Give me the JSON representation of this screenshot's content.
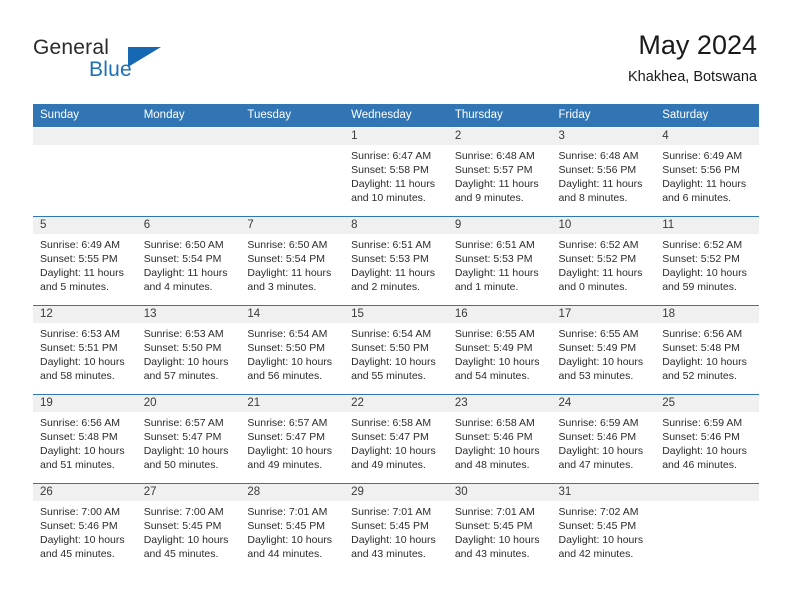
{
  "brand": {
    "name_part1": "General",
    "name_part2": "Blue",
    "accent_color": "#1668b3"
  },
  "header": {
    "title": "May 2024",
    "subtitle": "Khakhea, Botswana"
  },
  "theme": {
    "header_blue": "#3175b4",
    "daynum_strip": "#f0f0f0",
    "text": "#2b2b2b"
  },
  "weekdays": [
    "Sunday",
    "Monday",
    "Tuesday",
    "Wednesday",
    "Thursday",
    "Friday",
    "Saturday"
  ],
  "weeks": [
    [
      {
        "day": "",
        "sunrise": "",
        "sunset": "",
        "daylight1": "",
        "daylight2": ""
      },
      {
        "day": "",
        "sunrise": "",
        "sunset": "",
        "daylight1": "",
        "daylight2": ""
      },
      {
        "day": "",
        "sunrise": "",
        "sunset": "",
        "daylight1": "",
        "daylight2": ""
      },
      {
        "day": "1",
        "sunrise": "Sunrise: 6:47 AM",
        "sunset": "Sunset: 5:58 PM",
        "daylight1": "Daylight: 11 hours",
        "daylight2": "and 10 minutes."
      },
      {
        "day": "2",
        "sunrise": "Sunrise: 6:48 AM",
        "sunset": "Sunset: 5:57 PM",
        "daylight1": "Daylight: 11 hours",
        "daylight2": "and 9 minutes."
      },
      {
        "day": "3",
        "sunrise": "Sunrise: 6:48 AM",
        "sunset": "Sunset: 5:56 PM",
        "daylight1": "Daylight: 11 hours",
        "daylight2": "and 8 minutes."
      },
      {
        "day": "4",
        "sunrise": "Sunrise: 6:49 AM",
        "sunset": "Sunset: 5:56 PM",
        "daylight1": "Daylight: 11 hours",
        "daylight2": "and 6 minutes."
      }
    ],
    [
      {
        "day": "5",
        "sunrise": "Sunrise: 6:49 AM",
        "sunset": "Sunset: 5:55 PM",
        "daylight1": "Daylight: 11 hours",
        "daylight2": "and 5 minutes."
      },
      {
        "day": "6",
        "sunrise": "Sunrise: 6:50 AM",
        "sunset": "Sunset: 5:54 PM",
        "daylight1": "Daylight: 11 hours",
        "daylight2": "and 4 minutes."
      },
      {
        "day": "7",
        "sunrise": "Sunrise: 6:50 AM",
        "sunset": "Sunset: 5:54 PM",
        "daylight1": "Daylight: 11 hours",
        "daylight2": "and 3 minutes."
      },
      {
        "day": "8",
        "sunrise": "Sunrise: 6:51 AM",
        "sunset": "Sunset: 5:53 PM",
        "daylight1": "Daylight: 11 hours",
        "daylight2": "and 2 minutes."
      },
      {
        "day": "9",
        "sunrise": "Sunrise: 6:51 AM",
        "sunset": "Sunset: 5:53 PM",
        "daylight1": "Daylight: 11 hours",
        "daylight2": "and 1 minute."
      },
      {
        "day": "10",
        "sunrise": "Sunrise: 6:52 AM",
        "sunset": "Sunset: 5:52 PM",
        "daylight1": "Daylight: 11 hours",
        "daylight2": "and 0 minutes."
      },
      {
        "day": "11",
        "sunrise": "Sunrise: 6:52 AM",
        "sunset": "Sunset: 5:52 PM",
        "daylight1": "Daylight: 10 hours",
        "daylight2": "and 59 minutes."
      }
    ],
    [
      {
        "day": "12",
        "sunrise": "Sunrise: 6:53 AM",
        "sunset": "Sunset: 5:51 PM",
        "daylight1": "Daylight: 10 hours",
        "daylight2": "and 58 minutes."
      },
      {
        "day": "13",
        "sunrise": "Sunrise: 6:53 AM",
        "sunset": "Sunset: 5:50 PM",
        "daylight1": "Daylight: 10 hours",
        "daylight2": "and 57 minutes."
      },
      {
        "day": "14",
        "sunrise": "Sunrise: 6:54 AM",
        "sunset": "Sunset: 5:50 PM",
        "daylight1": "Daylight: 10 hours",
        "daylight2": "and 56 minutes."
      },
      {
        "day": "15",
        "sunrise": "Sunrise: 6:54 AM",
        "sunset": "Sunset: 5:50 PM",
        "daylight1": "Daylight: 10 hours",
        "daylight2": "and 55 minutes."
      },
      {
        "day": "16",
        "sunrise": "Sunrise: 6:55 AM",
        "sunset": "Sunset: 5:49 PM",
        "daylight1": "Daylight: 10 hours",
        "daylight2": "and 54 minutes."
      },
      {
        "day": "17",
        "sunrise": "Sunrise: 6:55 AM",
        "sunset": "Sunset: 5:49 PM",
        "daylight1": "Daylight: 10 hours",
        "daylight2": "and 53 minutes."
      },
      {
        "day": "18",
        "sunrise": "Sunrise: 6:56 AM",
        "sunset": "Sunset: 5:48 PM",
        "daylight1": "Daylight: 10 hours",
        "daylight2": "and 52 minutes."
      }
    ],
    [
      {
        "day": "19",
        "sunrise": "Sunrise: 6:56 AM",
        "sunset": "Sunset: 5:48 PM",
        "daylight1": "Daylight: 10 hours",
        "daylight2": "and 51 minutes."
      },
      {
        "day": "20",
        "sunrise": "Sunrise: 6:57 AM",
        "sunset": "Sunset: 5:47 PM",
        "daylight1": "Daylight: 10 hours",
        "daylight2": "and 50 minutes."
      },
      {
        "day": "21",
        "sunrise": "Sunrise: 6:57 AM",
        "sunset": "Sunset: 5:47 PM",
        "daylight1": "Daylight: 10 hours",
        "daylight2": "and 49 minutes."
      },
      {
        "day": "22",
        "sunrise": "Sunrise: 6:58 AM",
        "sunset": "Sunset: 5:47 PM",
        "daylight1": "Daylight: 10 hours",
        "daylight2": "and 49 minutes."
      },
      {
        "day": "23",
        "sunrise": "Sunrise: 6:58 AM",
        "sunset": "Sunset: 5:46 PM",
        "daylight1": "Daylight: 10 hours",
        "daylight2": "and 48 minutes."
      },
      {
        "day": "24",
        "sunrise": "Sunrise: 6:59 AM",
        "sunset": "Sunset: 5:46 PM",
        "daylight1": "Daylight: 10 hours",
        "daylight2": "and 47 minutes."
      },
      {
        "day": "25",
        "sunrise": "Sunrise: 6:59 AM",
        "sunset": "Sunset: 5:46 PM",
        "daylight1": "Daylight: 10 hours",
        "daylight2": "and 46 minutes."
      }
    ],
    [
      {
        "day": "26",
        "sunrise": "Sunrise: 7:00 AM",
        "sunset": "Sunset: 5:46 PM",
        "daylight1": "Daylight: 10 hours",
        "daylight2": "and 45 minutes."
      },
      {
        "day": "27",
        "sunrise": "Sunrise: 7:00 AM",
        "sunset": "Sunset: 5:45 PM",
        "daylight1": "Daylight: 10 hours",
        "daylight2": "and 45 minutes."
      },
      {
        "day": "28",
        "sunrise": "Sunrise: 7:01 AM",
        "sunset": "Sunset: 5:45 PM",
        "daylight1": "Daylight: 10 hours",
        "daylight2": "and 44 minutes."
      },
      {
        "day": "29",
        "sunrise": "Sunrise: 7:01 AM",
        "sunset": "Sunset: 5:45 PM",
        "daylight1": "Daylight: 10 hours",
        "daylight2": "and 43 minutes."
      },
      {
        "day": "30",
        "sunrise": "Sunrise: 7:01 AM",
        "sunset": "Sunset: 5:45 PM",
        "daylight1": "Daylight: 10 hours",
        "daylight2": "and 43 minutes."
      },
      {
        "day": "31",
        "sunrise": "Sunrise: 7:02 AM",
        "sunset": "Sunset: 5:45 PM",
        "daylight1": "Daylight: 10 hours",
        "daylight2": "and 42 minutes."
      },
      {
        "day": "",
        "sunrise": "",
        "sunset": "",
        "daylight1": "",
        "daylight2": ""
      }
    ]
  ]
}
